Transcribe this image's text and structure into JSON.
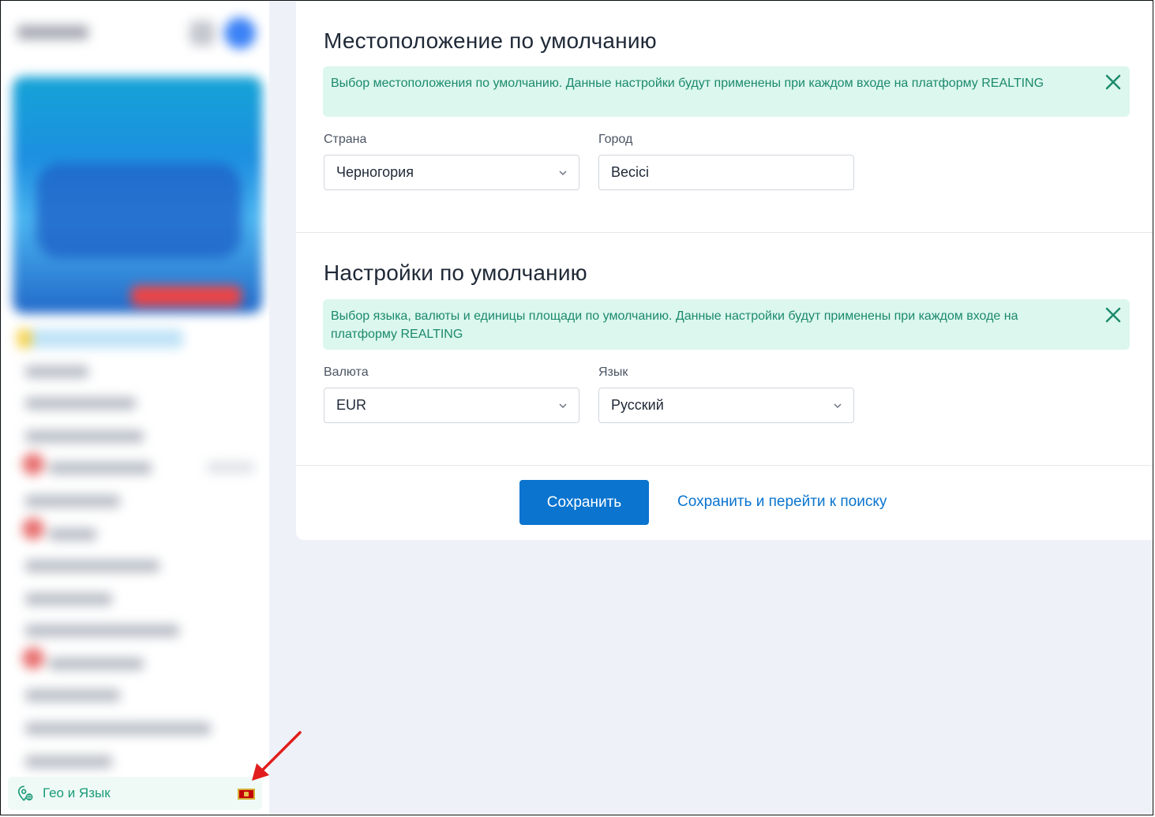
{
  "sidebar": {
    "geo_item": {
      "label": "Гео и Язык",
      "flag": "montenegro-flag"
    },
    "colors": {
      "accent": "#1a9a78",
      "highlight_bg": "#effaf6"
    }
  },
  "location_section": {
    "title": "Местоположение по умолчанию",
    "notice": "Выбор местоположения по умолчанию. Данные настройки будут применены при каждом входе на платформу REALTING",
    "country": {
      "label": "Страна",
      "value": "Черногория"
    },
    "city": {
      "label": "Город",
      "value": "Becici"
    }
  },
  "defaults_section": {
    "title": "Настройки по умолчанию",
    "notice": "Выбор языка, валюты и единицы площади по умолчанию. Данные настройки будут применены при каждом входе на платформу REALTING",
    "currency": {
      "label": "Валюта",
      "value": "EUR"
    },
    "language": {
      "label": "Язык",
      "value": "Русский"
    }
  },
  "actions": {
    "save_label": "Сохранить",
    "save_and_search_label": "Сохранить и перейти к поиску"
  },
  "colors": {
    "primary": "#0a74cf",
    "notice_bg": "#dcf7ee",
    "notice_text": "#1b8a6b",
    "arrow": "#e11d1d"
  }
}
